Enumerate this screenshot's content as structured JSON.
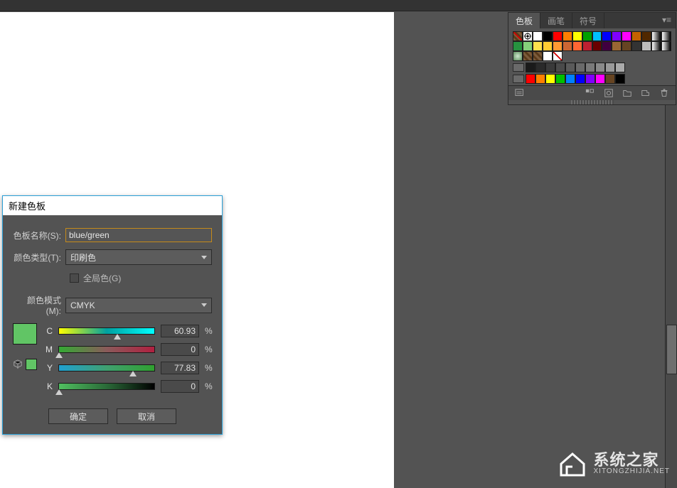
{
  "panel": {
    "tabs": [
      "色板",
      "画笔",
      "符号"
    ],
    "active_tab_index": 0,
    "footer_icons": [
      "swatch-libraries-icon",
      "swatch-types-icon",
      "swatch-options-icon",
      "new-group-icon",
      "new-swatch-icon",
      "delete-icon"
    ]
  },
  "swatch_rows": [
    [
      "none",
      "reg",
      "#ffffff",
      "#000000",
      "#ff0000",
      "#ff7f00",
      "#ffff00",
      "#00a000",
      "#00c0ff",
      "#0000ff",
      "#8000ff",
      "#ff00ff",
      "#c46200",
      "#502800",
      "grad1",
      "grad2"
    ],
    [
      "#26923f",
      "#84d07a",
      "#ffe14d",
      "#ffcc33",
      "#ff9933",
      "#cc6633",
      "#ff6633",
      "#bd2031",
      "#6a0000",
      "#400040",
      "#996633",
      "#664422",
      "#333333",
      "#bbbbbb",
      "grad3",
      "grad4"
    ],
    [
      "marble",
      "tex1",
      "tex2",
      "#fff",
      "diag"
    ]
  ],
  "gray_row": [
    "#1a1a1a",
    "#2a2a2a",
    "#3a3a3a",
    "#4a4a4a",
    "#5a5a5a",
    "#6a6a6a",
    "#7a7a7a",
    "#8a8a8a",
    "#9a9a9a",
    "#aaaaaa"
  ],
  "color_row": [
    "#ff0000",
    "#ff8000",
    "#ffff00",
    "#00c000",
    "#0080ff",
    "#0000ff",
    "#8000ff",
    "#ff00ff",
    "#664422",
    "#000000"
  ],
  "dialog": {
    "title": "新建色板",
    "name_label": "色板名称(S):",
    "name_value": "blue/green",
    "type_label": "颜色类型(T):",
    "type_value": "印刷色",
    "global_label": "全局色(G)",
    "global_checked": false,
    "mode_label": "颜色模式(M):",
    "mode_value": "CMYK",
    "preview_color": "#61c565",
    "sliders": {
      "C": {
        "value": "60.93",
        "pct": 60.93,
        "gradient": "linear-gradient(90deg,#ffff00,#00a0a0,#00ffff)"
      },
      "M": {
        "value": "0",
        "pct": 0,
        "gradient": "linear-gradient(90deg,#33aa33,#8a5a5a,#b02040)"
      },
      "Y": {
        "value": "77.83",
        "pct": 77.83,
        "gradient": "linear-gradient(90deg,#20a0d0,#40a070,#30a030)"
      },
      "K": {
        "value": "0",
        "pct": 0,
        "gradient": "linear-gradient(90deg,#50c060,#2a6a38,#000000)"
      }
    },
    "ok_label": "确定",
    "cancel_label": "取消"
  },
  "watermark": {
    "cn": "系统之家",
    "en": "XITONGZHIJIA.NET"
  }
}
